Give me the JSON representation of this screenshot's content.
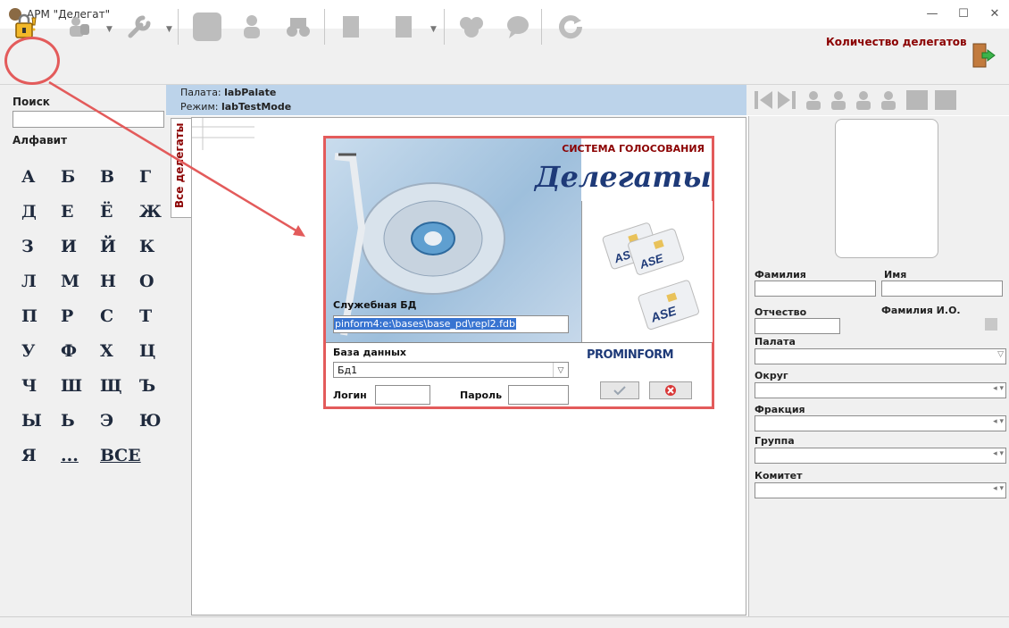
{
  "window": {
    "title": "АРМ \"Делегат\"",
    "minimize": "—",
    "maximize": "☐",
    "close": "✕"
  },
  "toolbar": {
    "count_label": "Количество делегатов",
    "buttons": [
      "lock-icon",
      "users-icon",
      "wrench-icon",
      "stop-icon",
      "person-icon",
      "binoculars-icon",
      "document-icon",
      "document2-icon",
      "group-icon",
      "chat-icon",
      "refresh-icon"
    ],
    "exit_icon": "exit-door-icon"
  },
  "left": {
    "search_label": "Поиск",
    "search_value": "",
    "alphabet_label": "Алфавит",
    "letters": [
      "А",
      "Б",
      "В",
      "Г",
      "Д",
      "Е",
      "Ё",
      "Ж",
      "З",
      "И",
      "Й",
      "К",
      "Л",
      "М",
      "Н",
      "О",
      "П",
      "Р",
      "С",
      "Т",
      "У",
      "Ф",
      "Х",
      "Ц",
      "Ч",
      "Ш",
      "Щ",
      "Ъ",
      "Ы",
      "Ь",
      "Э",
      "Ю",
      "Я",
      "...",
      "ВСЕ"
    ]
  },
  "center": {
    "chamber_label": "Палата:",
    "chamber_value": "labPalate",
    "mode_label": "Режим:",
    "mode_value": "labTestMode",
    "tab_label": "Все делегаты"
  },
  "dialog": {
    "system_title": "СИСТЕМА ГОЛОСОВАНИЯ",
    "brand": "Делегаты",
    "service_db_label": "Служебная БД",
    "service_db_value": "pinform4:e:\\bases\\base_pd\\repl2.fdb",
    "db_label": "База данных",
    "db_value": "Бд1",
    "login_label": "Логин",
    "login_value": "",
    "password_label": "Пароль",
    "password_value": "",
    "company": "PROMINFORM",
    "ok_icon": "check-icon",
    "cancel_icon": "cancel-icon"
  },
  "right": {
    "surname_label": "Фамилия",
    "name_label": "Имя",
    "patronymic_label": "Отчество",
    "short_name_label": "Фамилия И.О.",
    "chamber_label": "Палата",
    "district_label": "Округ",
    "faction_label": "Фракция",
    "group_label": "Группа",
    "committee_label": "Комитет"
  },
  "colors": {
    "accent_red": "#e35b5b",
    "header_blue": "#bcd3ea",
    "dark_red": "#8b0000"
  }
}
